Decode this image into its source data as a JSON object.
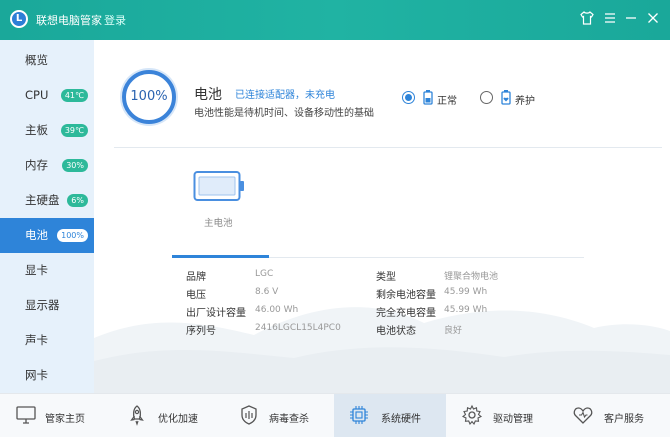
{
  "app": {
    "logo_letter": "L",
    "title": "联想电脑管家",
    "login": "登录"
  },
  "window_controls": [
    "shirt-icon",
    "menu-icon",
    "minimize-icon",
    "close-icon"
  ],
  "sidebar": {
    "items": [
      {
        "label": "概览",
        "badge": ""
      },
      {
        "label": "CPU",
        "badge": "41℃"
      },
      {
        "label": "主板",
        "badge": "39℃"
      },
      {
        "label": "内存",
        "badge": "30%"
      },
      {
        "label": "主硬盘",
        "badge": "6%"
      },
      {
        "label": "电池",
        "badge": "100%",
        "active": true
      },
      {
        "label": "显卡",
        "badge": ""
      },
      {
        "label": "显示器",
        "badge": ""
      },
      {
        "label": "声卡",
        "badge": ""
      },
      {
        "label": "网卡",
        "badge": ""
      }
    ]
  },
  "device": {
    "percent": "100%",
    "title": "电池",
    "status": "已连接适配器，未充电",
    "description": "电池性能是待机时间、设备移动性的基础",
    "modes": [
      {
        "label": "正常",
        "selected": true
      },
      {
        "label": "养护",
        "selected": false
      }
    ]
  },
  "battery_tab": {
    "label": "主电池"
  },
  "specs": {
    "left": [
      {
        "key": "品牌",
        "value": "LGC"
      },
      {
        "key": "电压",
        "value": "8.6 V"
      },
      {
        "key": "出厂设计容量",
        "value": "46.00 Wh"
      },
      {
        "key": "序列号",
        "value": "2416LGCL15L4PC0"
      }
    ],
    "right": [
      {
        "key": "类型",
        "value": "锂聚合物电池"
      },
      {
        "key": "剩余电池容量",
        "value": "45.99 Wh"
      },
      {
        "key": "完全充电容量",
        "value": "45.99 Wh"
      },
      {
        "key": "电池状态",
        "value": "良好"
      }
    ]
  },
  "bottom_nav": [
    {
      "label": "管家主页",
      "icon": "monitor-icon"
    },
    {
      "label": "优化加速",
      "icon": "rocket-icon"
    },
    {
      "label": "病毒查杀",
      "icon": "shield-icon"
    },
    {
      "label": "系统硬件",
      "icon": "chip-icon",
      "active": true
    },
    {
      "label": "驱动管理",
      "icon": "gear-icon"
    },
    {
      "label": "客户服务",
      "icon": "heart-icon"
    }
  ],
  "colors": {
    "titlebar": "#1aa89a",
    "accent": "#2e84d9",
    "sidebar_bg": "#e6f1fb",
    "badge": "#2db99a"
  }
}
